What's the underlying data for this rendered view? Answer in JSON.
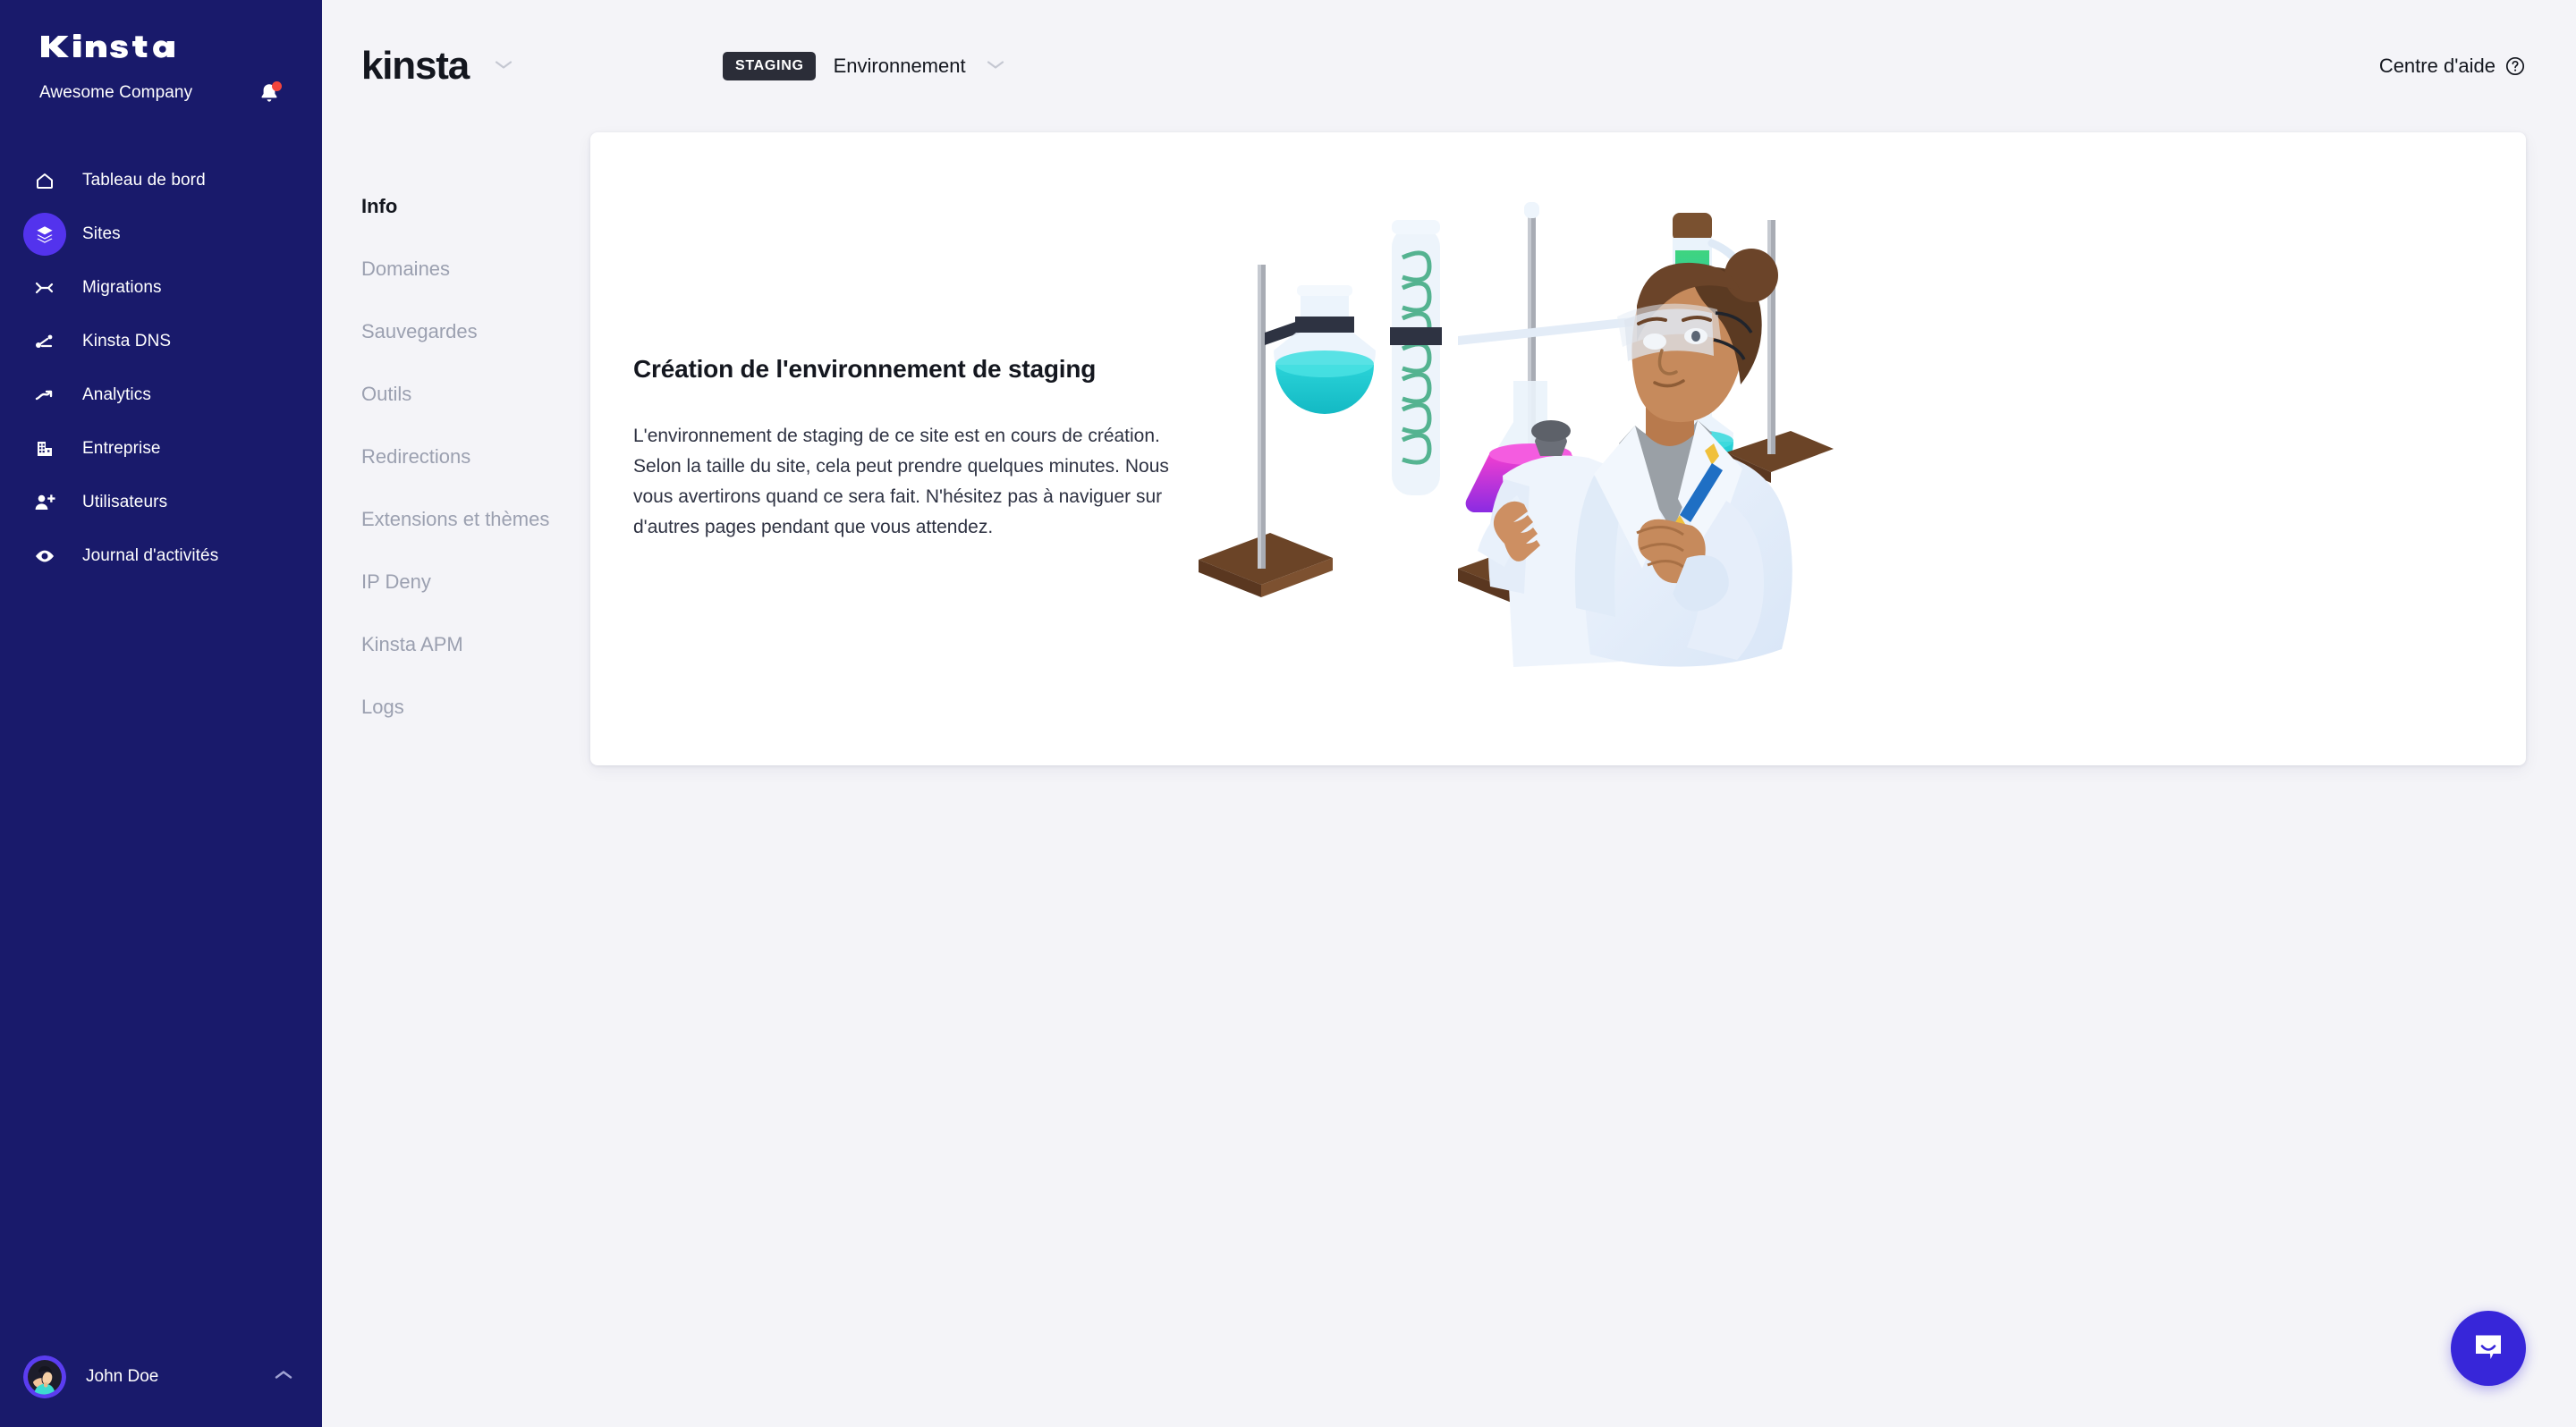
{
  "sidebar": {
    "logo_text": "Kinsta",
    "org_name": "Awesome Company",
    "notification_icon": "bell-icon",
    "has_notification": true,
    "items": [
      {
        "label": "Tableau de bord",
        "icon": "home-icon",
        "active": false
      },
      {
        "label": "Sites",
        "icon": "layers-icon",
        "active": true
      },
      {
        "label": "Migrations",
        "icon": "migration-arrow-icon",
        "active": false
      },
      {
        "label": "Kinsta DNS",
        "icon": "dns-nodes-icon",
        "active": false
      },
      {
        "label": "Analytics",
        "icon": "trend-up-icon",
        "active": false
      },
      {
        "label": "Entreprise",
        "icon": "building-icon",
        "active": false
      },
      {
        "label": "Utilisateurs",
        "icon": "user-plus-icon",
        "active": false
      },
      {
        "label": "Journal d'activités",
        "icon": "eye-icon",
        "active": false
      }
    ],
    "user": {
      "name": "John Doe",
      "caret_icon": "chevron-up-icon"
    }
  },
  "topbar": {
    "brand": "kinsta",
    "brand_caret_icon": "chevron-down-icon",
    "env_badge": "STAGING",
    "env_label": "Environnement",
    "env_caret_icon": "chevron-down-icon",
    "help_label": "Centre d'aide",
    "help_icon": "question-circle-icon"
  },
  "subnav": {
    "items": [
      {
        "label": "Info",
        "active": true
      },
      {
        "label": "Domaines",
        "active": false
      },
      {
        "label": "Sauvegardes",
        "active": false
      },
      {
        "label": "Outils",
        "active": false
      },
      {
        "label": "Redirections",
        "active": false
      },
      {
        "label": "Extensions et thèmes",
        "active": false
      },
      {
        "label": "IP Deny",
        "active": false
      },
      {
        "label": "Kinsta APM",
        "active": false
      },
      {
        "label": "Logs",
        "active": false
      }
    ]
  },
  "card": {
    "heading": "Création de l'environnement de staging",
    "body": "L'environnement de staging de ce site est en cours de création. Selon la taille du site, cela peut prendre quelques minutes. Nous vous avertirons quand ce sera fait. N'hésitez pas à naviguer sur d'autres pages pendant que vous attendez.",
    "illustration": "scientist-lab-illustration"
  },
  "intercom": {
    "icon": "chat-bubble-smile-icon"
  },
  "colors": {
    "sidebar_bg": "#191a6b",
    "accent_purple": "#5333ed",
    "page_bg": "#f4f4f8",
    "card_bg": "#ffffff",
    "text_dark": "#14171f",
    "text_muted": "#9ba0b0",
    "badge_dark": "#2b2d38",
    "notification_red": "#f2453d",
    "intercom_blue": "#3726d9"
  }
}
